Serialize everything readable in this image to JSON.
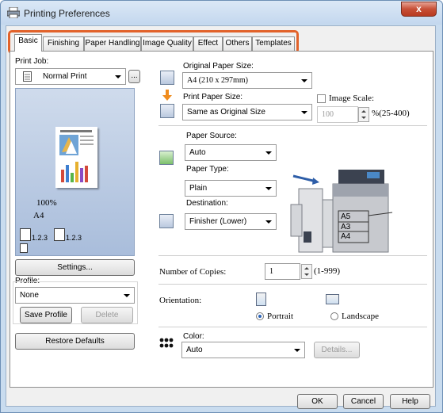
{
  "window": {
    "title": "Printing Preferences",
    "close_glyph": "x"
  },
  "tabs": [
    {
      "label": "Basic",
      "active": true
    },
    {
      "label": "Finishing"
    },
    {
      "label": "Paper Handling"
    },
    {
      "label": "Image Quality"
    },
    {
      "label": "Effect"
    },
    {
      "label": "Others"
    },
    {
      "label": "Templates"
    }
  ],
  "left": {
    "print_job_label": "Print Job:",
    "print_job_value": "Normal Print",
    "more_button": "...",
    "zoom": "100%",
    "paper_size": "A4",
    "copies_label_1": "1.2.3",
    "copies_label_2": "1.2.3",
    "settings_button": "Settings...",
    "profile_label": "Profile:",
    "profile_value": "None",
    "save_profile_button": "Save Profile",
    "delete_button": "Delete",
    "restore_defaults_button": "Restore Defaults"
  },
  "paper": {
    "original_size_label": "Original Paper Size:",
    "original_size_value": "A4 (210 x 297mm)",
    "print_size_label": "Print Paper Size:",
    "print_size_value": "Same as Original Size",
    "image_scale_label": "Image Scale:",
    "image_scale_value": "100",
    "image_scale_range": "%(25-400)",
    "source_label": "Paper Source:",
    "source_value": "Auto",
    "type_label": "Paper Type:",
    "type_value": "Plain",
    "destination_label": "Destination:",
    "destination_value": "Finisher (Lower)",
    "tray_a5": "A5",
    "tray_a3": "A3",
    "tray_a4": "A4"
  },
  "copies": {
    "label": "Number of Copies:",
    "value": "1",
    "range": "(1-999)"
  },
  "orientation": {
    "label": "Orientation:",
    "portrait": "Portrait",
    "landscape": "Landscape",
    "selected": "Portrait"
  },
  "color": {
    "label": "Color:",
    "value": "Auto",
    "details_button": "Details..."
  },
  "footer": {
    "ok": "OK",
    "cancel": "Cancel",
    "help": "Help"
  },
  "colors": {
    "tab_highlight": "#e2622a",
    "title_bar": "#c9dcef",
    "close_button": "#c74f36"
  }
}
